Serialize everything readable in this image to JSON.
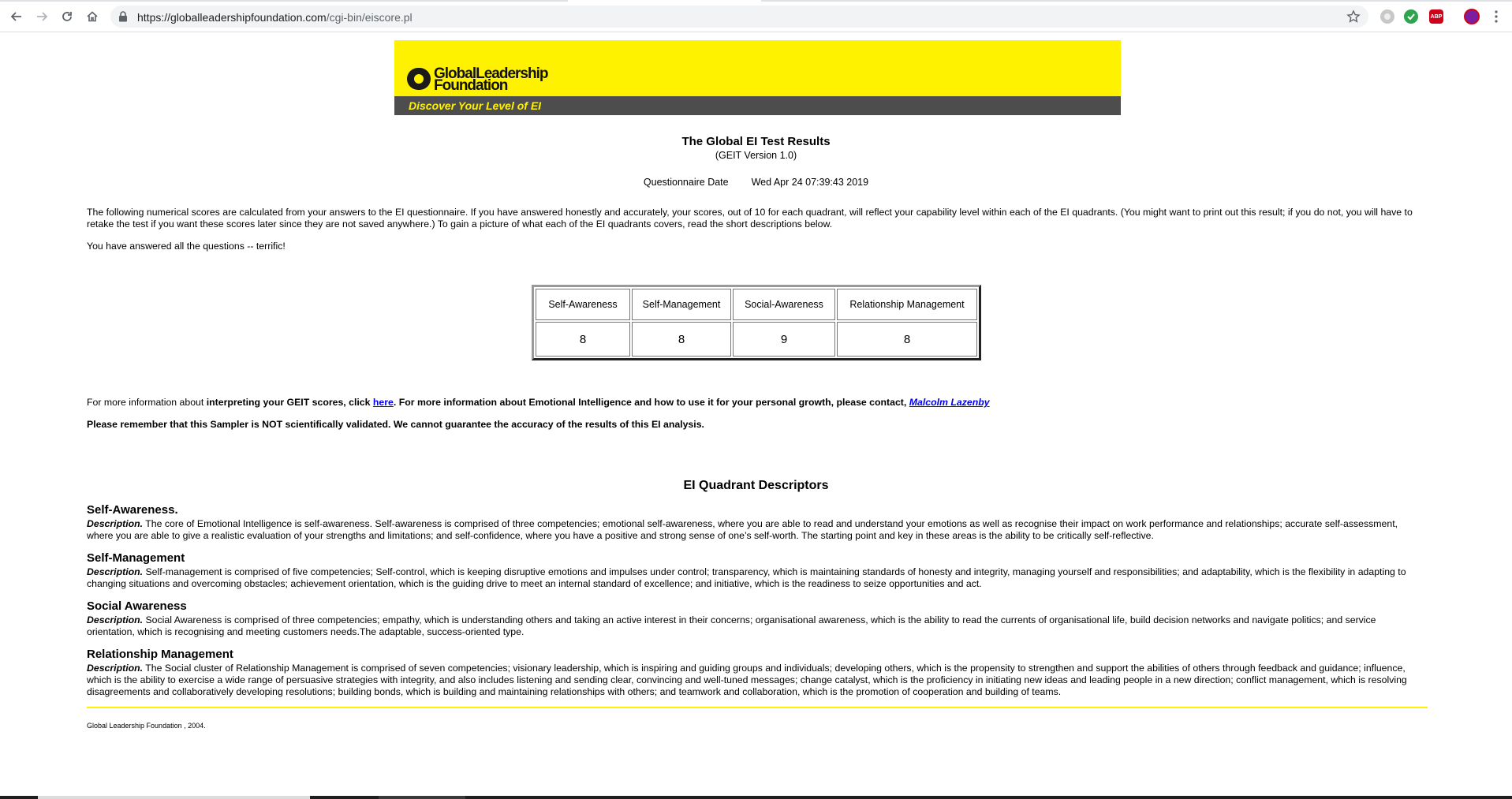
{
  "browser": {
    "url_host": "https://globalleadershipfoundation.com",
    "url_path": "/cgi-bin/eiscore.pl",
    "extensions": [
      "circle-extension-icon",
      "check-extension-icon",
      "adblock-plus-icon",
      "profile-avatar-icon"
    ],
    "abp_label": "ABP"
  },
  "banner": {
    "logo_line1": "GlobalLeadership",
    "logo_line2": "Foundation",
    "tagline": "Discover Your Level of EI"
  },
  "results": {
    "title": "The Global EI Test Results",
    "subtitle": "(GEIT Version 1.0)",
    "date_label": "Questionnaire Date",
    "date_value": "Wed Apr 24 07:39:43 2019"
  },
  "intro": {
    "paragraph": "The following numerical scores are calculated from your answers to the EI questionnaire. If you have answered honestly and accurately, your scores, out of 10 for each quadrant, will reflect your capability level within each of the EI quadrants. (You might want to print out this result; if you do not, you will have to retake the test if you want these scores later since they are not saved anywhere.) To gain a picture of what each of the EI quadrants covers, read the short descriptions below.",
    "answered": "You have answered all the questions -- terrific!"
  },
  "scores": {
    "headers": [
      "Self-Awareness",
      "Self-Management",
      "Social-Awareness",
      "Relationship Management"
    ],
    "values": [
      "8",
      "8",
      "9",
      "8"
    ]
  },
  "info": {
    "prefix": "For more information about ",
    "bold1": "interpreting your GEIT scores, click ",
    "link_here": "here",
    "bold2": ". For more information about Emotional Intelligence and how to use it for your personal growth, please contact, ",
    "link_contact": "Malcolm Lazenby",
    "disclaimer": "Please remember that this Sampler is NOT scientifically validated. We cannot guarantee the accuracy of the results of this EI analysis."
  },
  "descriptors": {
    "title": "EI Quadrant Descriptors",
    "desc_label": "Description.",
    "items": [
      {
        "heading": "Self-Awareness.",
        "text": " The core of Emotional Intelligence is self-awareness. Self-awareness is comprised of three competencies; emotional self-awareness, where you are able to read and understand your emotions as well as recognise their impact on work performance and relationships; accurate self-assessment, where you are able to give a realistic evaluation of your strengths and limitations; and self-confidence, where you have a positive and strong sense of one’s self-worth. The starting point and key in these areas is the ability to be critically self-reflective."
      },
      {
        "heading": "Self-Management",
        "text": " Self-management is comprised of five competencies; Self-control, which is keeping disruptive emotions and impulses under control; transparency, which is maintaining standards of honesty and integrity, managing yourself and responsibilities; and adaptability, which is the flexibility in adapting to changing situations and overcoming obstacles; achievement orientation, which is the guiding drive to meet an internal standard of excellence; and initiative, which is the readiness to seize opportunities and act."
      },
      {
        "heading": "Social Awareness",
        "text": " Social Awareness is comprised of three competencies; empathy, which is understanding others and taking an active interest in their concerns; organisational awareness, which is the ability to read the currents of organisational life, build decision networks and navigate politics; and service orientation, which is recognising and meeting customers needs.The adaptable, success-oriented type."
      },
      {
        "heading": "Relationship Management",
        "text": " The Social cluster of Relationship Management is comprised of seven competencies; visionary leadership, which is inspiring and guiding groups and individuals; developing others, which is the propensity to strengthen and support the abilities of others through feedback and guidance; influence, which is the ability to exercise a wide range of persuasive strategies with integrity, and also includes listening and sending clear, convincing and well-tuned messages; change catalyst, which is the proficiency in initiating new ideas and leading people in a new direction; conflict management, which is resolving disagreements and collaboratively developing resolutions; building bonds, which is building and maintaining relationships with others; and teamwork and collaboration, which is the promotion of cooperation and building of teams."
      }
    ]
  },
  "footer": {
    "text": "Global Leadership Foundation , 2004."
  },
  "colors": {
    "banner_yellow": "#fff200",
    "banner_gray": "#4d4d4d",
    "link_blue": "#0000ee"
  }
}
